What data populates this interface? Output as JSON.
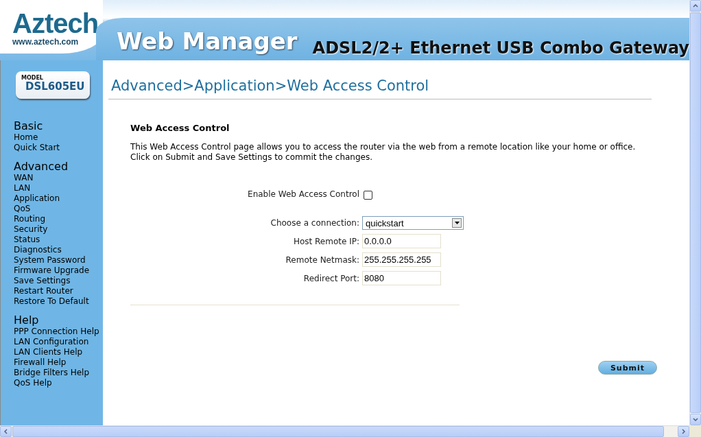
{
  "header": {
    "brand": "Aztech",
    "brand_url": "www.aztech.com",
    "title": "Web Manager",
    "product": "ADSL2/2+ Ethernet USB Combo Gateway"
  },
  "sidebar": {
    "model_label": "MODEL",
    "model": "DSL605EU",
    "sections": [
      {
        "title": "Basic",
        "items": [
          "Home",
          "Quick Start"
        ]
      },
      {
        "title": "Advanced",
        "items": [
          "WAN",
          "LAN",
          "Application",
          "QoS",
          "Routing",
          "Security",
          "Status",
          "Diagnostics",
          "System Password",
          "Firmware Upgrade",
          "Save Settings",
          "Restart Router",
          "Restore To Default"
        ]
      },
      {
        "title": "Help",
        "items": [
          "PPP Connection Help",
          "LAN Configuration",
          "LAN Clients Help",
          "Firewall Help",
          "Bridge Filters Help",
          "QoS Help"
        ]
      }
    ]
  },
  "page": {
    "breadcrumb": "Advanced>Application>Web Access Control",
    "heading": "Web Access Control",
    "description": [
      "This Web Access Control page allows you to access the router via the web from a remote location like your home or office.",
      "Click on Submit and Save Settings to commit the changes."
    ],
    "form": [
      {
        "kind": "checkbox",
        "label": "Enable Web Access Control",
        "checked": false
      },
      {
        "kind": "select",
        "label": "Choose a connection:",
        "value": "quickstart"
      },
      {
        "kind": "text",
        "label": "Host Remote IP:",
        "value": "0.0.0.0"
      },
      {
        "kind": "text",
        "label": "Remote Netmask:",
        "value": "255.255.255.255"
      },
      {
        "kind": "text",
        "label": "Redirect Port:",
        "value": "8080"
      }
    ],
    "submit": "Submit"
  }
}
